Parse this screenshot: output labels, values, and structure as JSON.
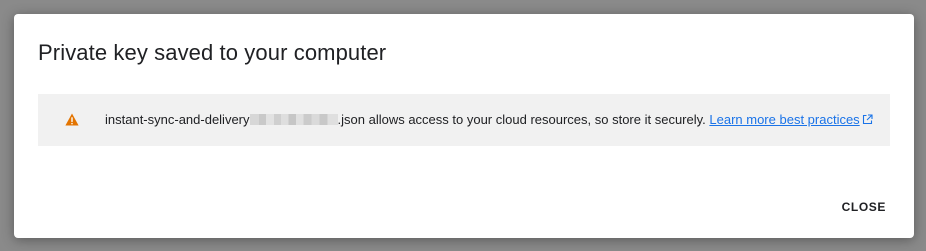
{
  "dialog": {
    "title": "Private key saved to your computer",
    "notice": {
      "icon": "warning-icon",
      "filename_prefix": "instant-sync-and-delivery",
      "message_suffix": ".json allows access to your cloud resources, so store it securely.",
      "link_label": "Learn more best practices",
      "link_icon": "external-link-icon"
    },
    "close_label": "CLOSE"
  },
  "colors": {
    "warning": "#e37400",
    "link": "#1a73e8",
    "notice_background": "#f1f1f1",
    "backdrop": "#8a8a8a"
  }
}
